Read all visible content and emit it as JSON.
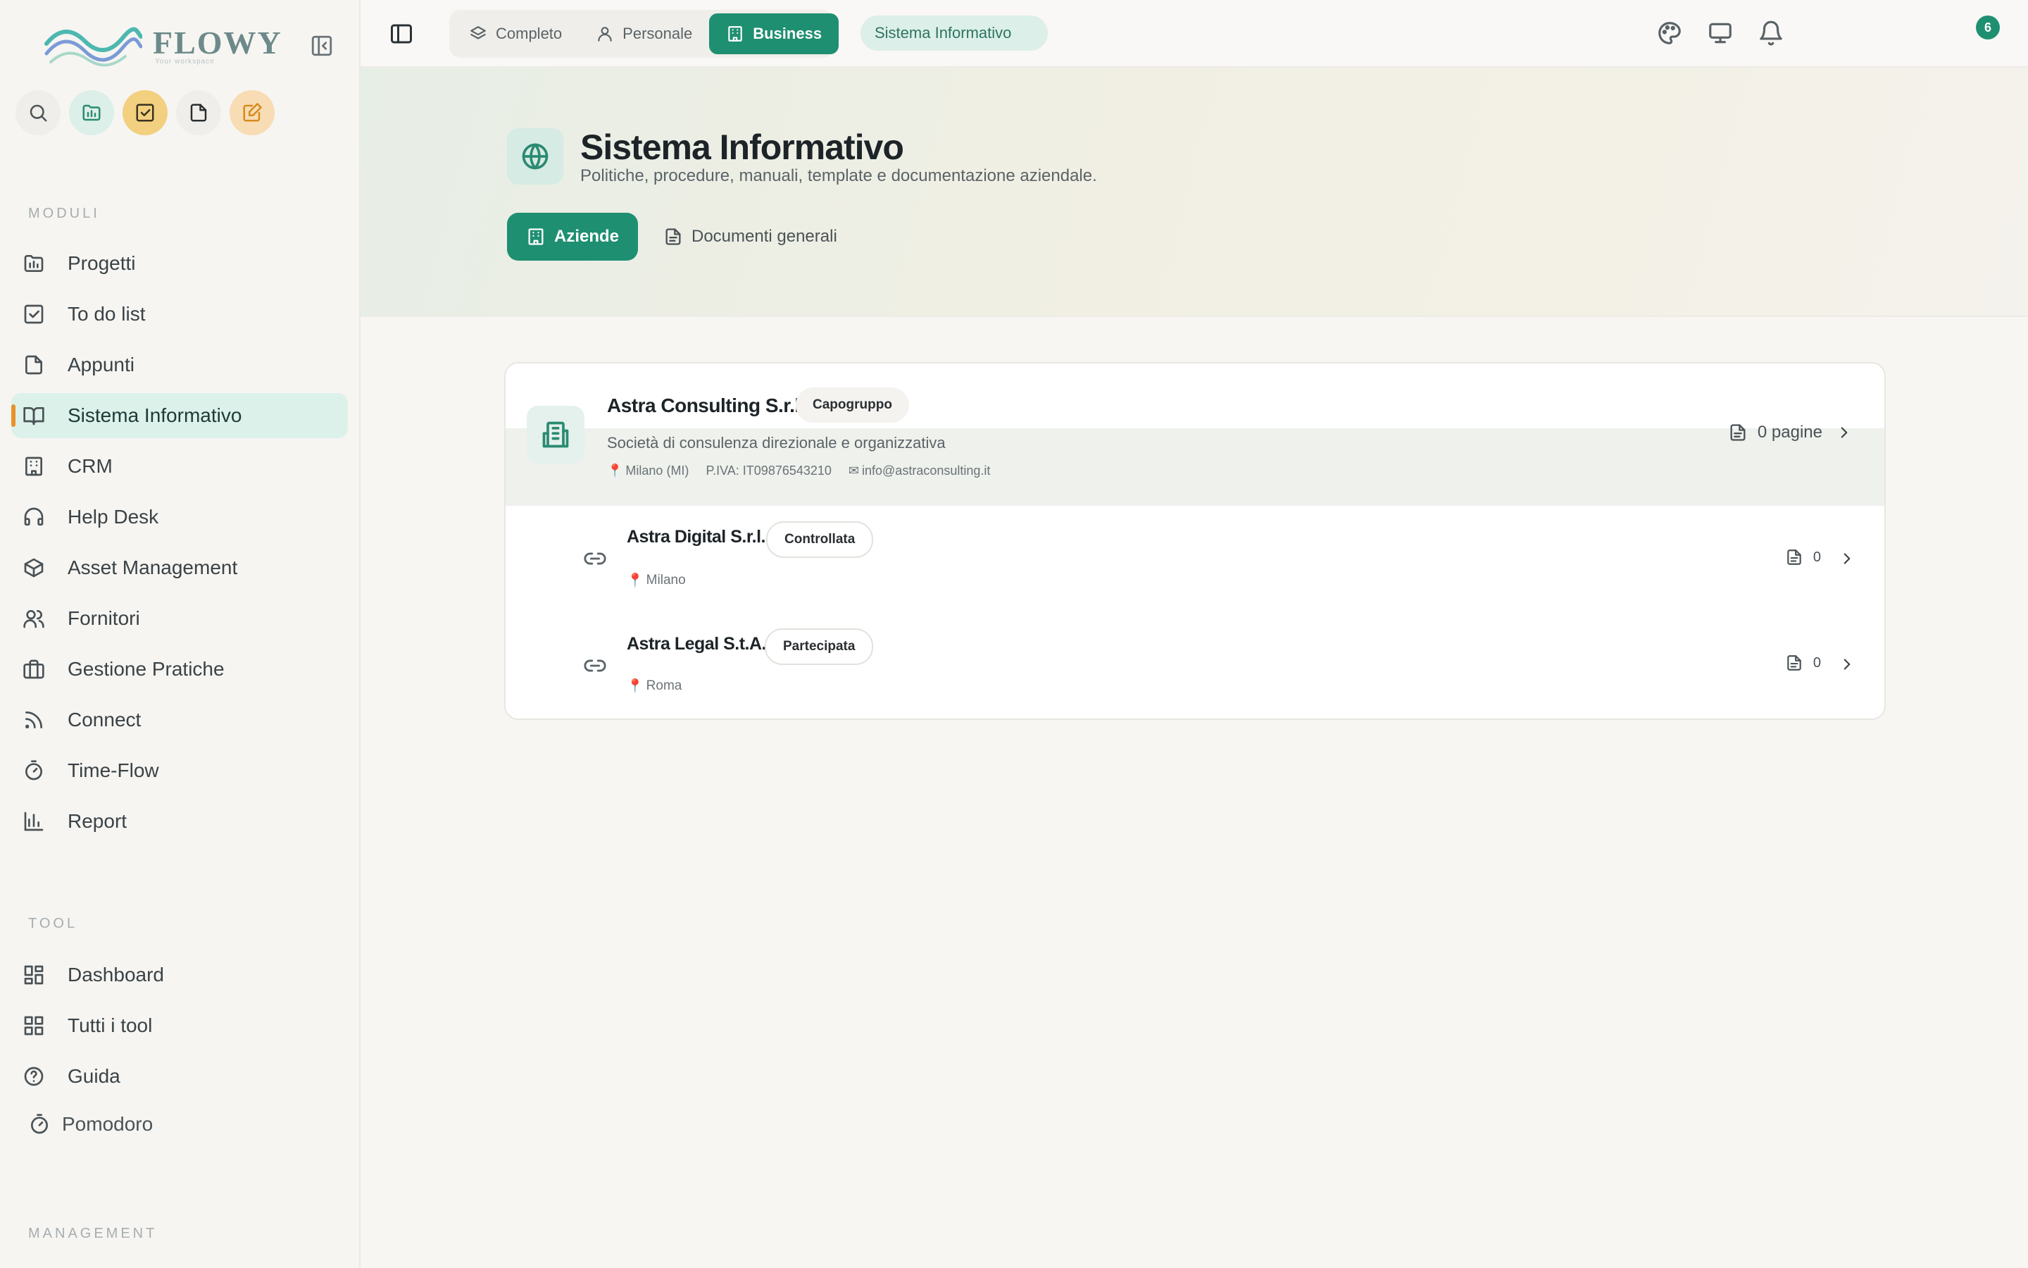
{
  "brand": {
    "name": "FLOWY",
    "tagline": "Your workspace",
    "colors": {
      "primary": "#1f8f71",
      "accent": "#e8922c",
      "wave_teal": "#4db8b0",
      "wave_blue": "#7b9bd6"
    }
  },
  "sidebar": {
    "collapse_icon": "sidebar-collapse-icon",
    "quick_actions": [
      {
        "name": "search",
        "icon": "search-icon"
      },
      {
        "name": "projects",
        "icon": "folder-chart-icon"
      },
      {
        "name": "todo",
        "icon": "check-square-icon"
      },
      {
        "name": "notes",
        "icon": "file-icon"
      },
      {
        "name": "edit",
        "icon": "edit-note-icon"
      }
    ],
    "modules_label": "MODULI",
    "modules": [
      {
        "label": "Progetti",
        "icon": "folder-chart-icon",
        "active": false
      },
      {
        "label": "To do list",
        "icon": "check-square-icon",
        "active": false
      },
      {
        "label": "Appunti",
        "icon": "file-icon",
        "active": false
      },
      {
        "label": "Sistema Informativo",
        "icon": "book-open-icon",
        "active": true
      },
      {
        "label": "CRM",
        "icon": "building-icon",
        "active": false
      },
      {
        "label": "Help Desk",
        "icon": "headset-icon",
        "active": false
      },
      {
        "label": "Asset Management",
        "icon": "package-icon",
        "active": false
      },
      {
        "label": "Fornitori",
        "icon": "users-icon",
        "active": false
      },
      {
        "label": "Gestione Pratiche",
        "icon": "briefcase-icon",
        "active": false
      },
      {
        "label": "Connect",
        "icon": "rss-icon",
        "active": false
      },
      {
        "label": "Time-Flow",
        "icon": "timer-icon",
        "active": false
      },
      {
        "label": "Report",
        "icon": "bar-chart-icon",
        "active": false
      }
    ],
    "tools_label": "TOOL",
    "tools": [
      {
        "label": "Dashboard",
        "icon": "dashboard-icon"
      },
      {
        "label": "Tutti i tool",
        "icon": "grid-icon"
      },
      {
        "label": "Guida",
        "icon": "help-circle-icon"
      }
    ],
    "pomodoro": {
      "label": "Pomodoro",
      "icon": "timer-icon"
    },
    "management_label": "MANAGEMENT"
  },
  "topbar": {
    "panel_toggle_icon": "panel-left-icon",
    "workspace_tabs": [
      {
        "label": "Completo",
        "icon": "layers-icon",
        "active": false
      },
      {
        "label": "Personale",
        "icon": "user-icon",
        "active": false
      },
      {
        "label": "Business",
        "icon": "building-icon",
        "active": true
      }
    ],
    "breadcrumb": "Sistema Informativo",
    "icons": [
      "palette-icon",
      "monitor-icon",
      "bell-icon"
    ],
    "notification_count": "6"
  },
  "hero": {
    "icon": "globe-icon",
    "title": "Sistema Informativo",
    "subtitle": "Politiche, procedure, manuali, template e documentazione aziendale.",
    "tabs": [
      {
        "label": "Aziende",
        "icon": "building-icon",
        "active": true
      },
      {
        "label": "Documenti generali",
        "icon": "file-text-icon",
        "active": false
      }
    ]
  },
  "companies": {
    "parent": {
      "name": "Astra Consulting S.r.l.",
      "badge": "Capogruppo",
      "description": "Società di consulenza direzionale e organizzativa",
      "location": "Milano (MI)",
      "vat": "P.IVA: IT09876543210",
      "email": "info@astraconsulting.it",
      "pages": "0 pagine"
    },
    "children": [
      {
        "name": "Astra Digital S.r.l.",
        "badge": "Controllata",
        "city": "Milano",
        "count": "0"
      },
      {
        "name": "Astra Legal S.t.A.",
        "badge": "Partecipata",
        "city": "Roma",
        "count": "0"
      }
    ]
  }
}
